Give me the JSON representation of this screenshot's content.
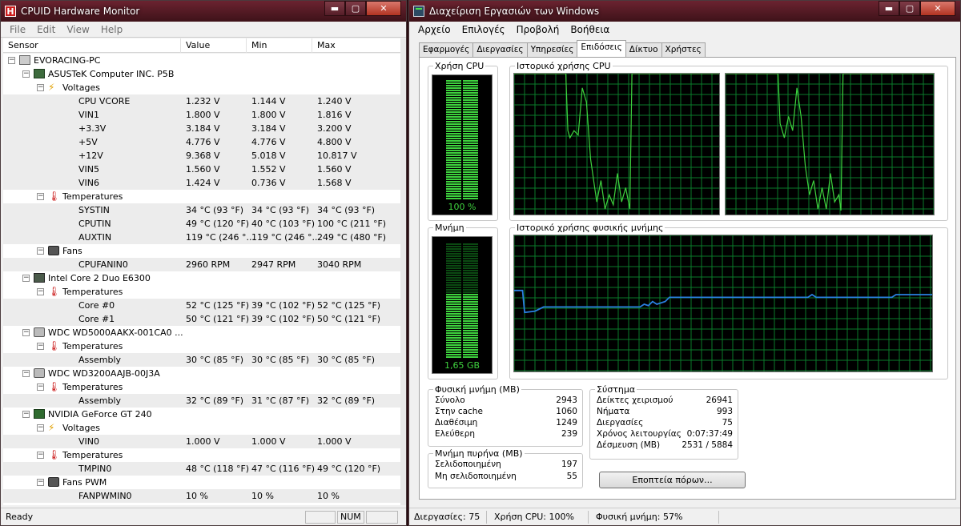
{
  "hwmon": {
    "title": "CPUID Hardware Monitor",
    "menu": [
      "File",
      "Edit",
      "View",
      "Help"
    ],
    "columns": [
      "Sensor",
      "Value",
      "Min",
      "Max"
    ],
    "rows": [
      {
        "level": 0,
        "icon": "computer-icon",
        "label": "EVORACING-PC"
      },
      {
        "level": 1,
        "icon": "motherboard-icon",
        "label": "ASUSTeK Computer INC. P5B"
      },
      {
        "level": 2,
        "icon": "voltage-icon",
        "label": "Voltages"
      },
      {
        "level": 3,
        "label": "CPU VCORE",
        "value": "1.232 V",
        "min": "1.144 V",
        "max": "1.240 V"
      },
      {
        "level": 3,
        "label": "VIN1",
        "value": "1.800 V",
        "min": "1.800 V",
        "max": "1.816 V"
      },
      {
        "level": 3,
        "label": "+3.3V",
        "value": "3.184 V",
        "min": "3.184 V",
        "max": "3.200 V"
      },
      {
        "level": 3,
        "label": "+5V",
        "value": "4.776 V",
        "min": "4.776 V",
        "max": "4.800 V"
      },
      {
        "level": 3,
        "label": "+12V",
        "value": "9.368 V",
        "min": "5.018 V",
        "max": "10.817 V"
      },
      {
        "level": 3,
        "label": "VIN5",
        "value": "1.560 V",
        "min": "1.552 V",
        "max": "1.560 V"
      },
      {
        "level": 3,
        "label": "VIN6",
        "value": "1.424 V",
        "min": "0.736 V",
        "max": "1.568 V"
      },
      {
        "level": 2,
        "icon": "thermometer-icon",
        "label": "Temperatures"
      },
      {
        "level": 3,
        "label": "SYSTIN",
        "value": "34 °C  (93 °F)",
        "min": "34 °C  (93 °F)",
        "max": "34 °C  (93 °F)"
      },
      {
        "level": 3,
        "label": "CPUTIN",
        "value": "49 °C  (120 °F)",
        "min": "40 °C  (103 °F)",
        "max": "100 °C  (211 °F)"
      },
      {
        "level": 3,
        "label": "AUXTIN",
        "value": "119 °C  (246 °...",
        "min": "119 °C  (246 °...",
        "max": "249 °C  (480 °F)"
      },
      {
        "level": 2,
        "icon": "fan-icon",
        "label": "Fans"
      },
      {
        "level": 3,
        "label": "CPUFANIN0",
        "value": "2960 RPM",
        "min": "2947 RPM",
        "max": "3040 RPM"
      },
      {
        "level": 1,
        "icon": "cpu-icon",
        "label": "Intel Core 2 Duo E6300"
      },
      {
        "level": 2,
        "icon": "thermometer-icon",
        "label": "Temperatures"
      },
      {
        "level": 3,
        "label": "Core #0",
        "value": "52 °C  (125 °F)",
        "min": "39 °C  (102 °F)",
        "max": "52 °C  (125 °F)"
      },
      {
        "level": 3,
        "label": "Core #1",
        "value": "50 °C  (121 °F)",
        "min": "39 °C  (102 °F)",
        "max": "50 °C  (121 °F)"
      },
      {
        "level": 1,
        "icon": "hard-drive-icon",
        "label": "WDC WD5000AAKX-001CA0 ..."
      },
      {
        "level": 2,
        "icon": "thermometer-icon",
        "label": "Temperatures"
      },
      {
        "level": 3,
        "label": "Assembly",
        "value": "30 °C  (85 °F)",
        "min": "30 °C  (85 °F)",
        "max": "30 °C  (85 °F)"
      },
      {
        "level": 1,
        "icon": "hard-drive-icon",
        "label": "WDC WD3200AAJB-00J3A"
      },
      {
        "level": 2,
        "icon": "thermometer-icon",
        "label": "Temperatures"
      },
      {
        "level": 3,
        "label": "Assembly",
        "value": "32 °C  (89 °F)",
        "min": "31 °C  (87 °F)",
        "max": "32 °C  (89 °F)"
      },
      {
        "level": 1,
        "icon": "graphics-card-icon",
        "label": "NVIDIA GeForce GT 240"
      },
      {
        "level": 2,
        "icon": "voltage-icon",
        "label": "Voltages"
      },
      {
        "level": 3,
        "label": "VIN0",
        "value": "1.000 V",
        "min": "1.000 V",
        "max": "1.000 V"
      },
      {
        "level": 2,
        "icon": "thermometer-icon",
        "label": "Temperatures"
      },
      {
        "level": 3,
        "label": "TMPIN0",
        "value": "48 °C  (118 °F)",
        "min": "47 °C  (116 °F)",
        "max": "49 °C  (120 °F)"
      },
      {
        "level": 2,
        "icon": "fan-icon",
        "label": "Fans PWM"
      },
      {
        "level": 3,
        "label": "FANPWMIN0",
        "value": "10 %",
        "min": "10 %",
        "max": "10 %"
      }
    ],
    "status": "Ready",
    "status_num": "NUM"
  },
  "taskmgr": {
    "title": "Διαχείριση Εργασιών των Windows",
    "menu": [
      "Αρχείο",
      "Επιλογές",
      "Προβολή",
      "Βοήθεια"
    ],
    "tabs": [
      "Εφαρμογές",
      "Διεργασίες",
      "Υπηρεσίες",
      "Επιδόσεις",
      "Δίκτυο",
      "Χρήστες"
    ],
    "active_tab": 3,
    "cpu_usage_title": "Χρήση CPU",
    "cpu_usage_label": "100 %",
    "cpu_usage_fraction": 1.0,
    "cpu_history_title": "Ιστορικό χρήσης CPU",
    "memory_title": "Μνήμη",
    "memory_label": "1,65 GB",
    "memory_fraction": 0.57,
    "memory_history_title": "Ιστορικό χρήσης φυσικής μνήμης",
    "physical_memory": {
      "title": "Φυσική μνήμη (MB)",
      "items": [
        {
          "label": "Σύνολο",
          "value": "2943"
        },
        {
          "label": "Στην cache",
          "value": "1060"
        },
        {
          "label": "Διαθέσιμη",
          "value": "1249"
        },
        {
          "label": "Ελεύθερη",
          "value": "239"
        }
      ]
    },
    "kernel_memory": {
      "title": "Μνήμη πυρήνα (MB)",
      "items": [
        {
          "label": "Σελιδοποιημένη",
          "value": "197"
        },
        {
          "label": "Μη σελιδοποιημένη",
          "value": "55"
        }
      ]
    },
    "system": {
      "title": "Σύστημα",
      "items": [
        {
          "label": "Δείκτες χειρισμού",
          "value": "26941"
        },
        {
          "label": "Νήματα",
          "value": "993"
        },
        {
          "label": "Διεργασίες",
          "value": "75"
        },
        {
          "label": "Χρόνος λειτουργίας",
          "value": "0:07:37:49"
        },
        {
          "label": "Δέσμευση (MB)",
          "value": "2531 / 5884"
        }
      ]
    },
    "resource_monitor_button": "Εποπτεία πόρων...",
    "status": {
      "processes": "Διεργασίες: 75",
      "cpu": "Χρήση CPU: 100%",
      "memory": "Φυσική μνήμη: 57%"
    },
    "colors": {
      "graph_green": "#3ed23e",
      "grid": "#0a7a2a",
      "memory_line": "#2a7fe0"
    }
  }
}
